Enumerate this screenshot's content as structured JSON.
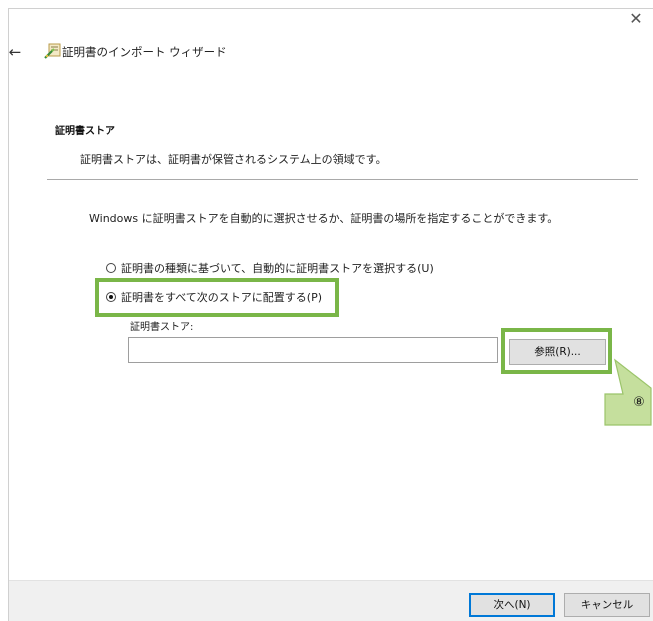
{
  "window": {
    "close_glyph": "✕",
    "back_glyph": "←",
    "title": "証明書のインポート ウィザード",
    "icon": "certificate-wizard-icon"
  },
  "header": {
    "section_title": "証明書ストア",
    "section_desc": "証明書ストアは、証明書が保管されるシステム上の領域です。"
  },
  "main": {
    "intro": "Windows に証明書ストアを自動的に選択させるか、証明書の場所を指定することができます。",
    "options": [
      {
        "label": "証明書の種類に基づいて、自動的に証明書ストアを選択する(U)",
        "selected": false
      },
      {
        "label": "証明書をすべて次のストアに配置する(P)",
        "selected": true
      }
    ],
    "store_label": "証明書ストア:",
    "store_value": "",
    "browse_label": "参照(R)...",
    "callout_number": "⑧"
  },
  "footer": {
    "next_label": "次へ(N)",
    "cancel_label": "キャンセル"
  },
  "colors": {
    "highlight": "#7ab648",
    "callout_fill": "#c5df9d",
    "callout_border": "#9bc46a",
    "footer_bg": "#f0f0f0"
  }
}
